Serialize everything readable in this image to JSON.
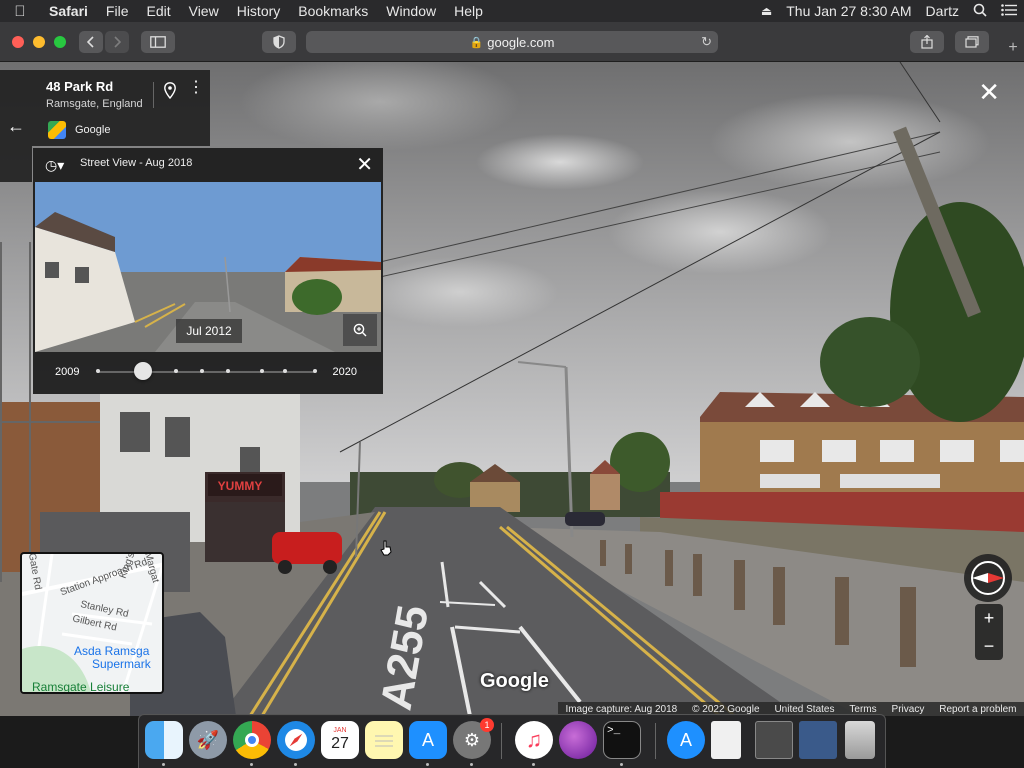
{
  "menubar": {
    "apple_icon": "apple-logo",
    "app_name": "Safari",
    "menus": [
      "File",
      "Edit",
      "View",
      "History",
      "Bookmarks",
      "Window",
      "Help"
    ],
    "datetime": "Thu Jan 27  8:30 AM",
    "user": "Dartz"
  },
  "toolbar": {
    "url": "google.com"
  },
  "address_card": {
    "title": "48 Park Rd",
    "subtitle": "Ramsgate, England",
    "source": "Google"
  },
  "time_machine": {
    "header": "Street View - Aug 2018",
    "selected_date": "Jul 2012",
    "year_start": "2009",
    "year_end": "2020",
    "slider_position_fraction": 0.2
  },
  "minimap": {
    "labels": {
      "station_approach": "Station Approach Rd",
      "stanley": "Stanley Rd",
      "gilbert": "Gilbert Rd",
      "kings": "King's",
      "margate": "Margat",
      "gate": "Gate Rd",
      "poi_line1": "Asda Ramsga",
      "poi_line2": "Supermark",
      "leisure": "Ramsgate Leisure"
    }
  },
  "watermark": "Google",
  "footer": {
    "capture": "Image capture: Aug 2018",
    "copyright": "© 2022 Google",
    "region": "United States",
    "terms": "Terms",
    "privacy": "Privacy",
    "report": "Report a problem"
  },
  "street_sign": "A255",
  "shop_sign": "YUMMY",
  "dock": {
    "calendar_month": "JAN",
    "calendar_day": "27",
    "settings_badge": "1",
    "terminal_prompt": ">_"
  },
  "colors": {
    "accent_red": "#ff5f57",
    "accent_yellow": "#febc2e",
    "accent_green": "#28c840"
  }
}
